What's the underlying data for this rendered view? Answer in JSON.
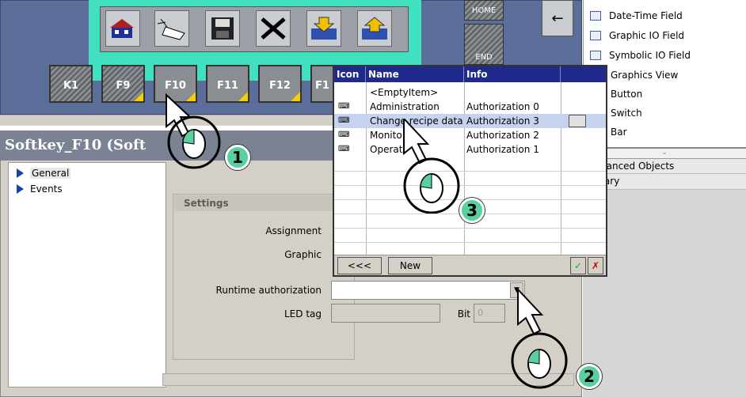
{
  "toolbar": {
    "icons": [
      "home-icon",
      "wizard-icon",
      "save-icon",
      "delete-icon",
      "download-icon",
      "upload-icon"
    ]
  },
  "top_right_buttons": {
    "home": "HOME",
    "end": "END"
  },
  "softkeys": [
    {
      "label": "K1"
    },
    {
      "label": "F9"
    },
    {
      "label": "F10"
    },
    {
      "label": "F11"
    },
    {
      "label": "F12"
    },
    {
      "label": "F1"
    }
  ],
  "toolbox": {
    "items": [
      {
        "label": "Date-Time Field",
        "icon": "datetime-icon"
      },
      {
        "label": "Graphic IO Field",
        "icon": "graphic-io-icon"
      },
      {
        "label": "Symbolic IO Field",
        "icon": "symbolic-io-icon"
      },
      {
        "label": "Graphics View",
        "icon": "graphics-view-icon"
      },
      {
        "label": "Button",
        "icon": "button-icon"
      },
      {
        "label": "Switch",
        "icon": "switch-icon"
      },
      {
        "label": "Bar",
        "icon": "bar-icon"
      }
    ],
    "section_enhanced": "hanced Objects",
    "section_library": "rary"
  },
  "props": {
    "title": "Softkey_F10 (Soft",
    "nav": [
      "General",
      "Events"
    ],
    "settings_title": "Settings",
    "labels": {
      "assignment": "Assignment",
      "graphic": "Graphic",
      "runtime_auth": "Runtime authorization",
      "led_tag": "LED tag",
      "bit": "Bit"
    },
    "bit_value": "0"
  },
  "popup": {
    "headers": [
      "Icon",
      "Name",
      "Info"
    ],
    "rows": [
      {
        "name": "<EmptyItem>",
        "info": ""
      },
      {
        "name": "Administration",
        "info": "Authorization 0"
      },
      {
        "name": "Change recipe data",
        "info": "Authorization 3"
      },
      {
        "name": "Monito",
        "info": "Authorization 2"
      },
      {
        "name": "Operat",
        "info": "Authorization 1"
      }
    ],
    "back_button": "<<<",
    "new_button": "New"
  },
  "callouts": [
    "1",
    "2",
    "3"
  ]
}
